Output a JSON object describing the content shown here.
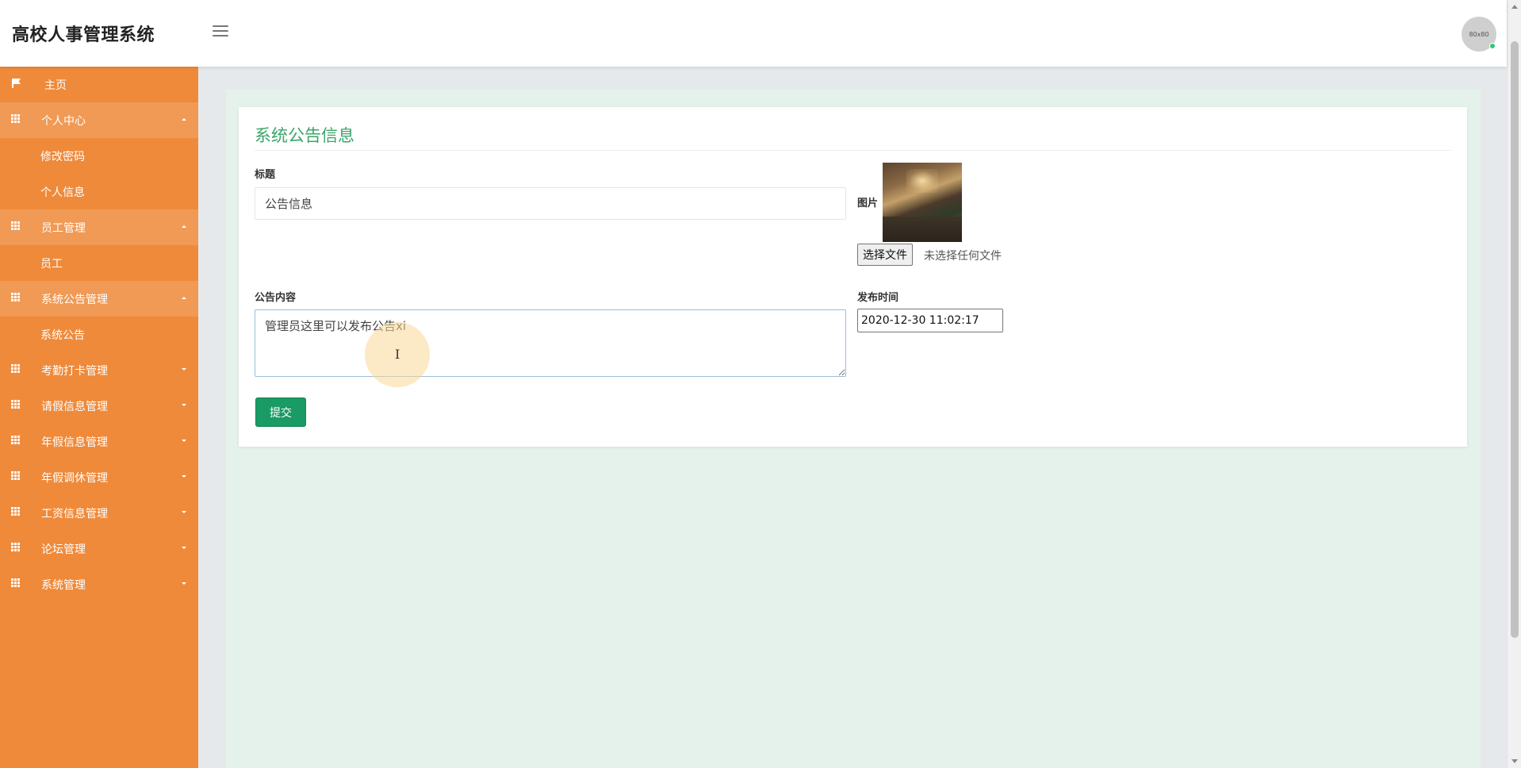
{
  "app": {
    "title": "高校人事管理系统"
  },
  "header": {
    "avatar_text": "80x80"
  },
  "sidebar": {
    "home": {
      "label": "主页"
    },
    "groups": [
      {
        "label": "个人中心",
        "children": [
          "修改密码",
          "个人信息"
        ]
      },
      {
        "label": "员工管理",
        "children": [
          "员工"
        ]
      },
      {
        "label": "系统公告管理",
        "children": [
          "系统公告"
        ]
      },
      {
        "label": "考勤打卡管理",
        "children": []
      },
      {
        "label": "请假信息管理",
        "children": []
      },
      {
        "label": "年假信息管理",
        "children": []
      },
      {
        "label": "年假调休管理",
        "children": []
      },
      {
        "label": "工资信息管理",
        "children": []
      },
      {
        "label": "论坛管理",
        "children": []
      },
      {
        "label": "系统管理",
        "children": []
      }
    ]
  },
  "form": {
    "title": "系统公告信息",
    "title_label": "标题",
    "title_value": "公告信息",
    "image_label": "图片",
    "file_button": "选择文件",
    "file_status": "未选择任何文件",
    "content_label": "公告内容",
    "content_value": "管理员这里可以发布公告xi",
    "date_label": "发布时间",
    "date_value": "2020-12-30 11:02:17",
    "submit": "提交"
  },
  "colors": {
    "sidebar": "#ef8a3a",
    "sidebar_open": "#f09a55",
    "accent_green": "#3aa56a",
    "submit": "#1a9a64",
    "content_bg": "#e5f2ec"
  }
}
